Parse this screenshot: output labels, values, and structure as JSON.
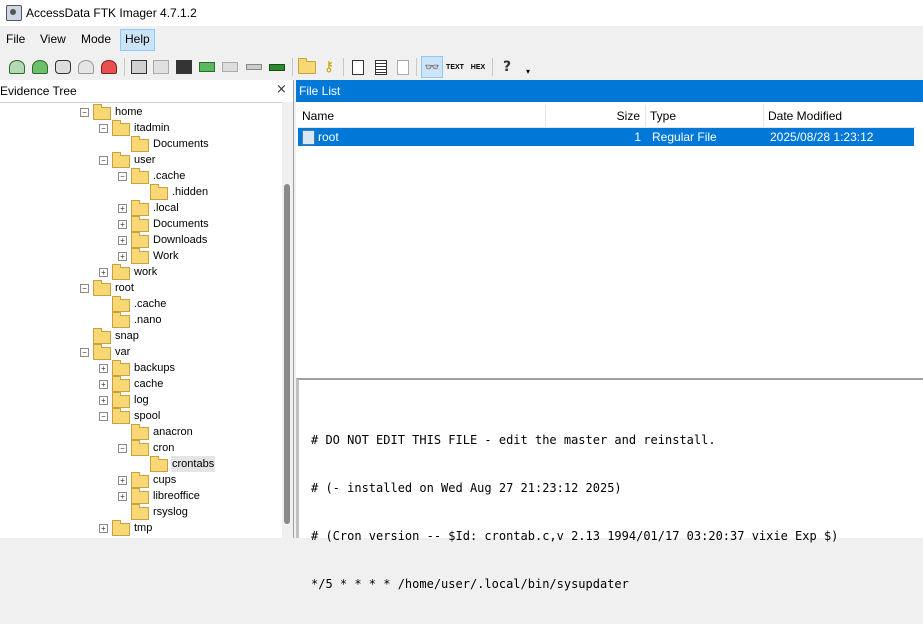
{
  "window": {
    "title": "AccessData FTK Imager 4.7.1.2"
  },
  "menu": [
    "File",
    "View",
    "Mode",
    "Help"
  ],
  "toolbar": {
    "icons": [
      "add-evidence-icon",
      "add-all-icon",
      "image-mounting-icon",
      "remove-evidence-icon",
      "remove-all-icon",
      "create-disk-image-icon",
      "export-disk-image-icon",
      "export-logical-image-icon",
      "add-to-image-icon",
      "create-custom-content-icon",
      "decrypt-icon",
      "verify-drive-icon",
      "capture-memory-icon",
      "obtain-protected-files-icon",
      "detect-efs-icon",
      "export-files-icon",
      "export-file-hash-icon",
      "export-directory-listing-icon",
      "auto-view-icon",
      "text-view-icon",
      "hex-view-icon",
      "help-icon"
    ],
    "text_label": "TEXT",
    "hex_label": "HEX"
  },
  "evidence_tree": {
    "header": "Evidence Tree",
    "close": "×",
    "nodes": [
      {
        "name": "home",
        "toggle": "−"
      },
      {
        "name": "itadmin",
        "toggle": "−"
      },
      {
        "name": "Documents",
        "toggle": ""
      },
      {
        "name": "user",
        "toggle": "−"
      },
      {
        "name": ".cache",
        "toggle": "−"
      },
      {
        "name": ".hidden",
        "toggle": ""
      },
      {
        "name": ".local",
        "toggle": "+"
      },
      {
        "name": "Documents",
        "toggle": "+"
      },
      {
        "name": "Downloads",
        "toggle": "+"
      },
      {
        "name": "Work",
        "toggle": "+"
      },
      {
        "name": "work",
        "toggle": "+"
      },
      {
        "name": "root",
        "toggle": "−"
      },
      {
        "name": ".cache",
        "toggle": ""
      },
      {
        "name": ".nano",
        "toggle": ""
      },
      {
        "name": "snap",
        "toggle": ""
      },
      {
        "name": "var",
        "toggle": "−"
      },
      {
        "name": "backups",
        "toggle": "+"
      },
      {
        "name": "cache",
        "toggle": "+"
      },
      {
        "name": "log",
        "toggle": "+"
      },
      {
        "name": "spool",
        "toggle": "−"
      },
      {
        "name": "anacron",
        "toggle": ""
      },
      {
        "name": "cron",
        "toggle": "−"
      },
      {
        "name": "crontabs",
        "toggle": ""
      },
      {
        "name": "cups",
        "toggle": "+"
      },
      {
        "name": "libreoffice",
        "toggle": "+"
      },
      {
        "name": "rsyslog",
        "toggle": ""
      },
      {
        "name": "tmp",
        "toggle": "+"
      }
    ]
  },
  "file_list": {
    "header": "File List",
    "columns": {
      "name": "Name",
      "size": "Size",
      "type": "Type",
      "date": "Date Modified"
    },
    "rows": [
      {
        "name": "root",
        "size": "1",
        "type": "Regular File",
        "date": "2025/08/28 1:23:12"
      }
    ]
  },
  "content": {
    "lines": [
      "# DO NOT EDIT THIS FILE - edit the master and reinstall.",
      "# (- installed on Wed Aug 27 21:23:12 2025)",
      "# (Cron version -- $Id: crontab.c,v 2.13 1994/01/17 03:20:37 vixie Exp $)",
      "*/5 * * * * /home/user/.local/bin/sysupdater"
    ]
  },
  "colors": {
    "accent": "#0078d7",
    "folder": "#f8d775",
    "menu_active": "#cce4f7"
  }
}
